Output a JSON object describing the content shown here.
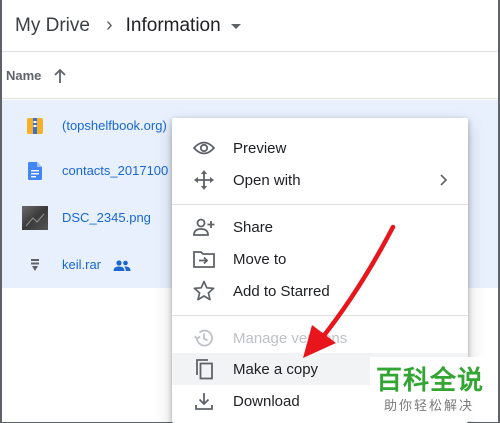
{
  "breadcrumb": {
    "root": "My Drive",
    "current": "Information"
  },
  "column_header": {
    "name_label": "Name"
  },
  "files": [
    {
      "name": "(topshelfbook.org)",
      "icon": "archive-icon"
    },
    {
      "name": "contacts_2017100",
      "icon": "docs-icon"
    },
    {
      "name": "DSC_2345.png",
      "icon": "image-thumbnail"
    },
    {
      "name": "keil.rar",
      "icon": "rar-archive-icon",
      "shared": true
    }
  ],
  "context_menu": {
    "preview": "Preview",
    "open_with": "Open with",
    "share": "Share",
    "move_to": "Move to",
    "add_to_starred": "Add to Starred",
    "manage_versions": "Manage versions",
    "make_a_copy": "Make a copy",
    "download": "Download"
  },
  "annotation": {
    "arrow_color": "#e8161c"
  },
  "watermark": {
    "main": "百科全说",
    "sub": "助你轻松解决"
  },
  "colors": {
    "selected_row_bg": "#e8f0fe",
    "file_name_blue": "#1967d2",
    "docs_blue": "#4285f4",
    "watermark_green": "#33a532"
  }
}
